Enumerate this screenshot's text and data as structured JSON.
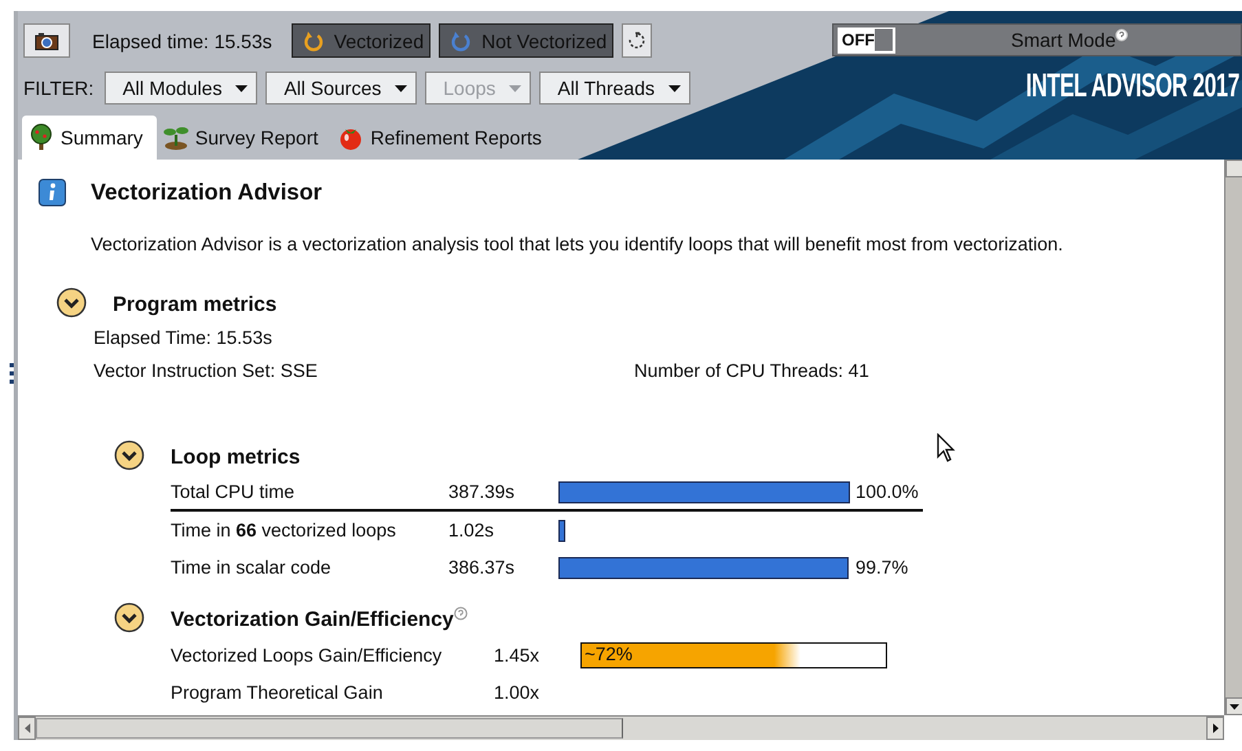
{
  "toolbar": {
    "elapsed": "Elapsed time: 15.53s",
    "toggles": [
      {
        "label": "Vectorized",
        "selected": true,
        "color": "#e8a020"
      },
      {
        "label": "Not Vectorized",
        "selected": true,
        "color": "#4a80d0"
      }
    ]
  },
  "smart_mode": {
    "switch": "OFF",
    "on": false,
    "label": "Smart Mode"
  },
  "logo": "INTEL ADVISOR 2017",
  "filter": {
    "label": "FILTER:",
    "dropdowns": [
      {
        "label": "All Modules",
        "disabled": false
      },
      {
        "label": "All Sources",
        "disabled": false
      },
      {
        "label": "Loops",
        "disabled": true
      },
      {
        "label": "All Threads",
        "disabled": false
      }
    ]
  },
  "tabs": [
    {
      "label": "Summary",
      "selected": true,
      "kind": "tree"
    },
    {
      "label": "Survey Report",
      "selected": false,
      "kind": "sprout"
    },
    {
      "label": "Refinement Reports",
      "selected": false,
      "kind": "tomato"
    }
  ],
  "summary": {
    "title": "Vectorization Advisor",
    "description": "Vectorization Advisor is a vectorization analysis tool that lets you identify loops that will benefit most from vectorization.",
    "program_metrics": {
      "title": "Program metrics",
      "expanded": true,
      "items": [
        "Elapsed Time: 15.53s",
        "Vector Instruction Set: SSE"
      ],
      "threads": "Number of CPU Threads: 41"
    },
    "loop_metrics": {
      "title": "Loop metrics",
      "expanded": true,
      "rows": [
        {
          "label": "Total CPU time",
          "value": "387.39s",
          "percent": "100.0%"
        },
        {
          "label": "Time in **66** vectorized loops",
          "value": "1.02s"
        },
        {
          "label": "Time in scalar code",
          "value": "386.37s",
          "percent": "99.7%"
        }
      ]
    },
    "gain": {
      "title": "Vectorization Gain/Efficiency",
      "expanded": true,
      "rows": [
        {
          "label": "Vectorized Loops Gain/Efficiency",
          "value": "1.45x",
          "level": 0.72,
          "bar_text": "~72%"
        },
        {
          "label": "Program Theoretical Gain",
          "value": "1.00x"
        }
      ]
    }
  }
}
